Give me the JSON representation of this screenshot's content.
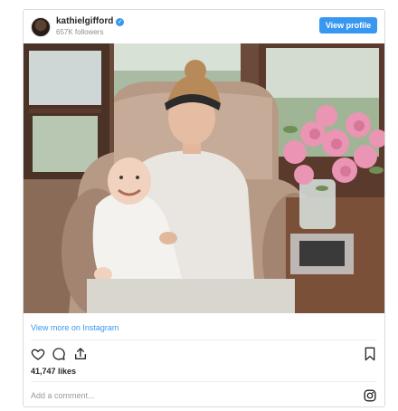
{
  "header": {
    "username": "kathielgifford",
    "verified_mark": "✓",
    "followers": "657K followers",
    "view_profile_label": "View profile"
  },
  "post": {
    "image_subject": "woman-holding-baby-in-armchair-with-pink-roses",
    "view_more_label": "View more on Instagram",
    "likes": "41,747 likes",
    "comment_placeholder": "Add a comment..."
  },
  "icons": {
    "like": "heart-icon",
    "comment": "comment-bubble-icon",
    "share": "share-icon",
    "save": "bookmark-icon",
    "brand": "instagram-icon"
  },
  "colors": {
    "accent": "#3897f0",
    "muted_text": "#8e8e8e",
    "border": "#dbdbdb"
  }
}
